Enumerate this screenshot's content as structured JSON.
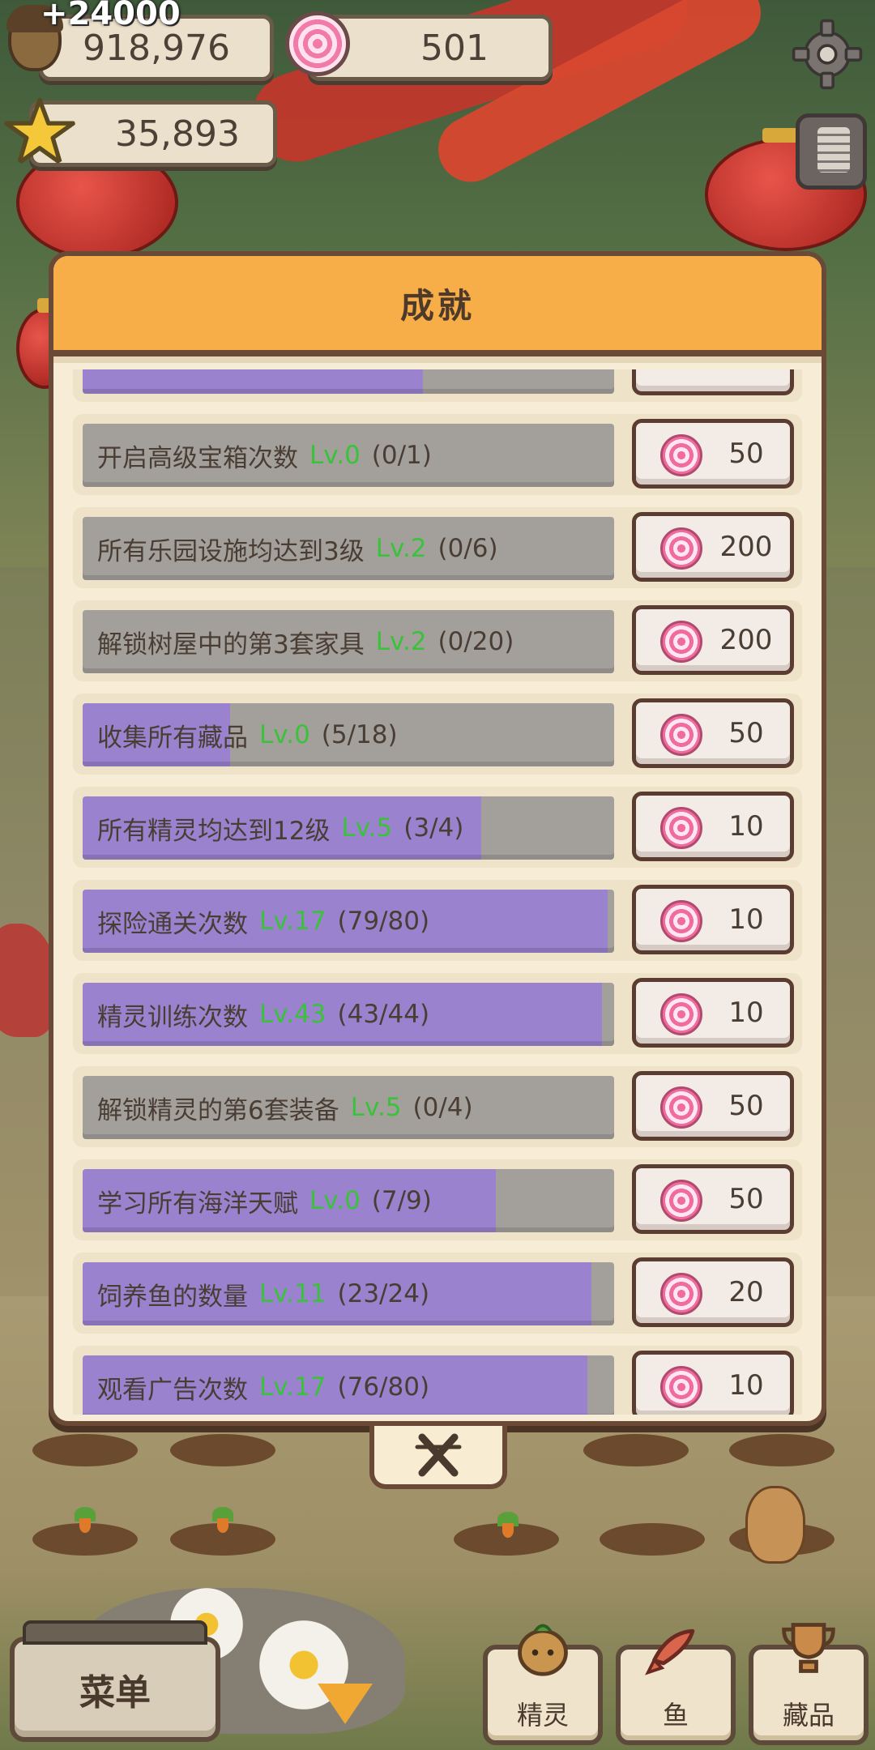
{
  "hud": {
    "float_text": "+24000",
    "acorns": "918,976",
    "candy": "501",
    "stars": "35,893"
  },
  "modal": {
    "title": "成就",
    "close_symbol": "X"
  },
  "achievements": [
    {
      "name": "开启高级宝箱次数",
      "level": "Lv.0",
      "progress": "(0/1)",
      "fill": 0,
      "reward": "50"
    },
    {
      "name": "所有乐园设施均达到3级",
      "level": "Lv.2",
      "progress": "(0/6)",
      "fill": 0,
      "reward": "200"
    },
    {
      "name": "解锁树屋中的第3套家具",
      "level": "Lv.2",
      "progress": "(0/20)",
      "fill": 0,
      "reward": "200"
    },
    {
      "name": "收集所有藏品",
      "level": "Lv.0",
      "progress": "(5/18)",
      "fill": 0.278,
      "reward": "50"
    },
    {
      "name": "所有精灵均达到12级",
      "level": "Lv.5",
      "progress": "(3/4)",
      "fill": 0.75,
      "reward": "10"
    },
    {
      "name": "探险通关次数",
      "level": "Lv.17",
      "progress": "(79/80)",
      "fill": 0.9875,
      "reward": "10"
    },
    {
      "name": "精灵训练次数",
      "level": "Lv.43",
      "progress": "(43/44)",
      "fill": 0.977,
      "reward": "10"
    },
    {
      "name": "解锁精灵的第6套装备",
      "level": "Lv.5",
      "progress": "(0/4)",
      "fill": 0,
      "reward": "50"
    },
    {
      "name": "学习所有海洋天赋",
      "level": "Lv.0",
      "progress": "(7/9)",
      "fill": 0.778,
      "reward": "50"
    },
    {
      "name": "饲养鱼的数量",
      "level": "Lv.11",
      "progress": "(23/24)",
      "fill": 0.958,
      "reward": "20"
    },
    {
      "name": "观看广告次数",
      "level": "Lv.17",
      "progress": "(76/80)",
      "fill": 0.95,
      "reward": "10"
    }
  ],
  "bottom_bar": {
    "menu": "菜单",
    "spirits": "精灵",
    "fish": "鱼",
    "collection": "藏品"
  },
  "colors": {
    "header": "#f8ae48",
    "progress_fill": "#9a82cf",
    "level_text": "#39c23a",
    "bar_empty": "#a3a09c"
  }
}
